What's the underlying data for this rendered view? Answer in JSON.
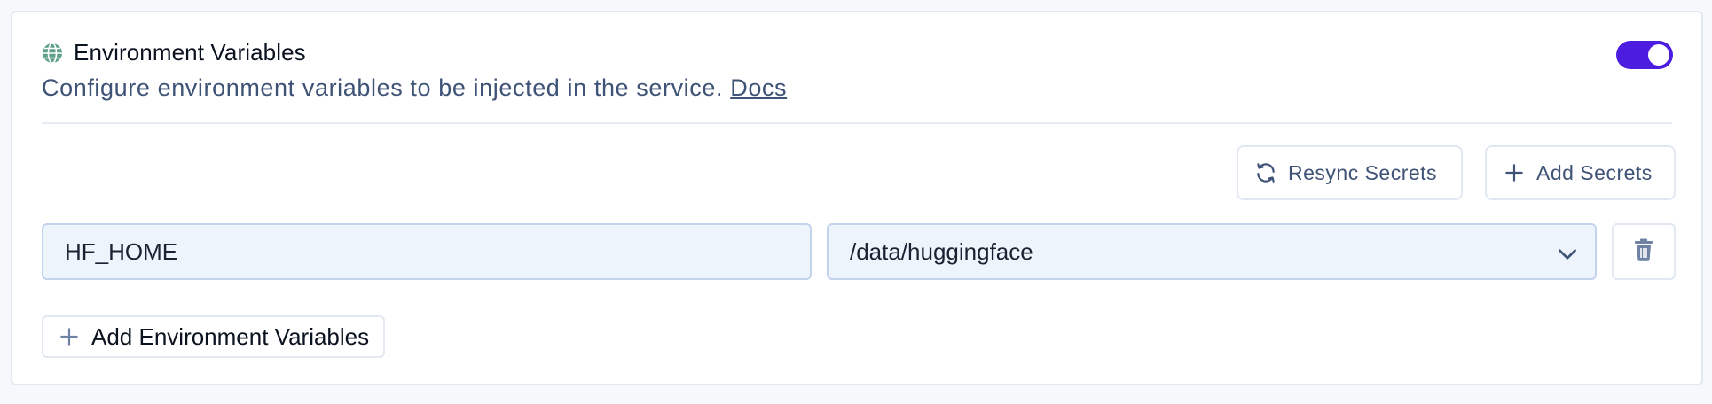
{
  "section": {
    "title": "Environment Variables",
    "description": "Configure environment variables to be injected in the service.",
    "docs_link": "Docs",
    "enabled": true,
    "accent_color": "#4c1de0",
    "icon": "globe-icon"
  },
  "actions": {
    "resync_label": "Resync Secrets",
    "resync_icon": "refresh-icon",
    "add_secrets_label": "Add Secrets",
    "add_secrets_icon": "plus-icon"
  },
  "variables": [
    {
      "key": "HF_HOME",
      "value": "/data/huggingface"
    }
  ],
  "footer": {
    "add_env_label": "Add Environment Variables",
    "add_env_icon": "plus-icon"
  }
}
